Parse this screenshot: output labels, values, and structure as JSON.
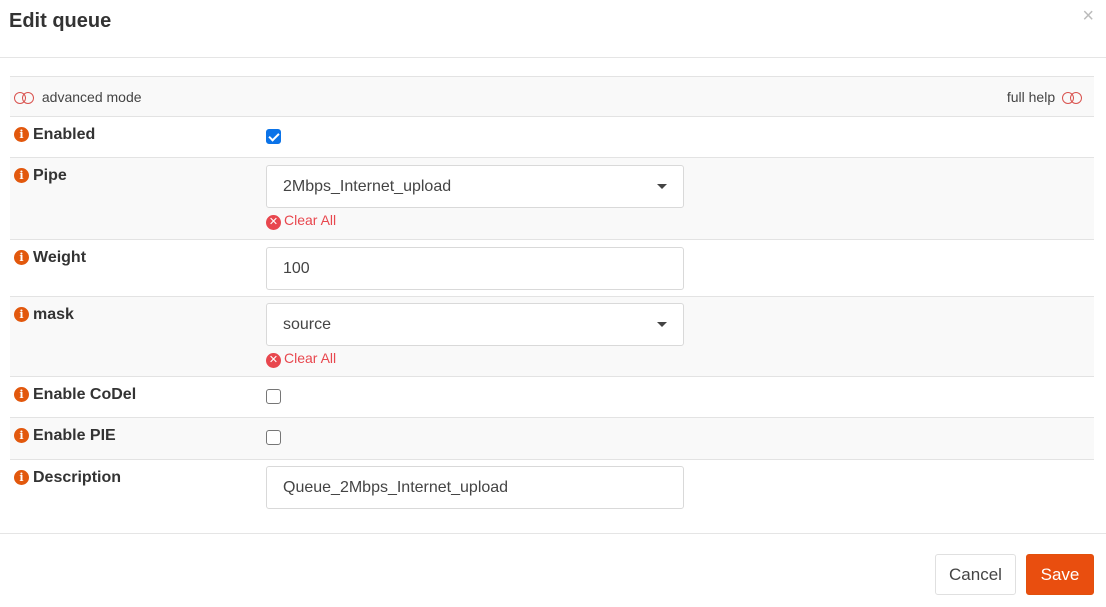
{
  "dialog": {
    "title": "Edit queue",
    "close_icon": "×"
  },
  "toolbar": {
    "advanced_mode_label": "advanced mode",
    "full_help_label": "full help"
  },
  "fields": {
    "enabled": {
      "label": "Enabled",
      "checked": true
    },
    "pipe": {
      "label": "Pipe",
      "value": "2Mbps_Internet_upload",
      "clear_label": "Clear All"
    },
    "weight": {
      "label": "Weight",
      "value": "100"
    },
    "mask": {
      "label": "mask",
      "value": "source",
      "clear_label": "Clear All"
    },
    "codel": {
      "label": "Enable CoDel",
      "checked": false
    },
    "pie": {
      "label": "Enable PIE",
      "checked": false
    },
    "description": {
      "label": "Description",
      "value": "Queue_2Mbps_Internet_upload"
    }
  },
  "icons": {
    "info": "i",
    "clear": "✕"
  },
  "footer": {
    "cancel_label": "Cancel",
    "save_label": "Save"
  },
  "colors": {
    "accent": "#e94e0f",
    "info_icon": "#e2580d",
    "clear_link": "#e8474e",
    "checkbox_checked": "#0b73e8"
  }
}
